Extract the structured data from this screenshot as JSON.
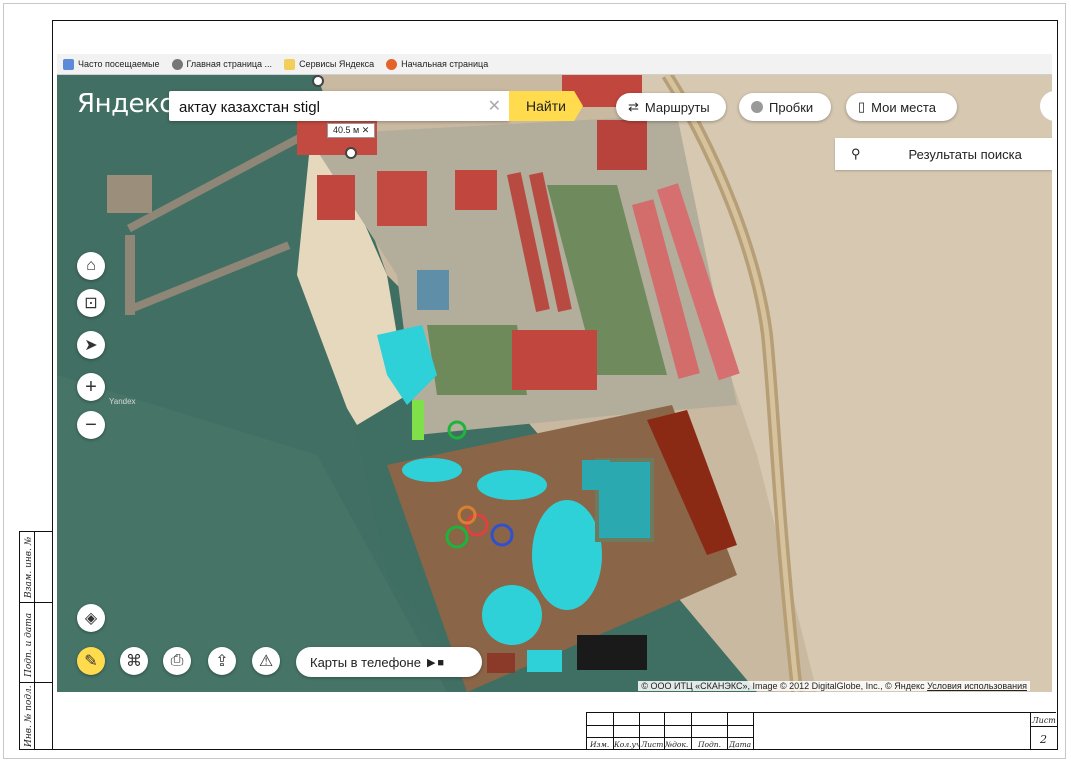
{
  "bookmarks": [
    {
      "label": "Часто посещаемые",
      "icon": "page-icon",
      "color": "#5b8bd6"
    },
    {
      "label": "Главная страница ...",
      "icon": "globe-icon",
      "color": "#777777"
    },
    {
      "label": "Сервисы Яндекса",
      "icon": "folder-icon",
      "color": "#f2cf5b"
    },
    {
      "label": "Начальная страница",
      "icon": "firefox-icon",
      "color": "#e4632b"
    }
  ],
  "map": {
    "logo": "Яндекс",
    "search": {
      "value": "актау казахстан stigl",
      "clear_icon": "close-icon"
    },
    "find_button": "Найти",
    "pills": [
      {
        "label": "Маршруты",
        "icon": "routes-icon"
      },
      {
        "label": "Пробки",
        "icon": "traffic-icon"
      },
      {
        "label": "Мои места",
        "icon": "bookmark-icon"
      }
    ],
    "results_label": "Результаты поиска",
    "ruler_label": "40.5 м",
    "watermark": "Yandex",
    "phone_pill": "Карты в телефоне",
    "copyright_text": "© ООО ИТЦ «СКАНЭКС», Image © 2012 DigitalGlobe, Inc., © Яндекс",
    "terms_link": "Условия использования",
    "colors": {
      "accent": "#ffdb4d",
      "water": "#3f6f62",
      "pool": "#2fd1d8",
      "roof": "#c0463e",
      "park_ground": "#8a6547"
    }
  },
  "stamp": {
    "side_labels": [
      "Инв. № подл.",
      "Подп. и дата",
      "Взам. инв. №"
    ],
    "columns": [
      "Изм.",
      "Кол.уч",
      "Лист",
      "№док.",
      "Подп.",
      "Дата"
    ],
    "sheet_label": "Лист",
    "sheet_number": "2"
  }
}
